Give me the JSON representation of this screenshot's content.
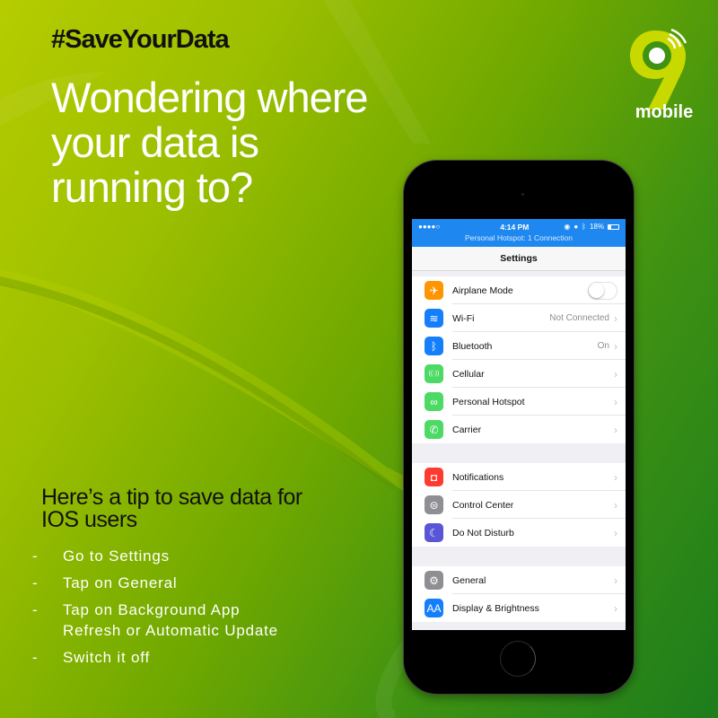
{
  "campaign": {
    "hashtag": "#SaveYourData",
    "headline": "Wondering where your data is running to?"
  },
  "brand": {
    "logo_icon": "9mobile-logo-icon",
    "name": "mobile",
    "colors": {
      "lime": "#b5cc00",
      "green": "#1d7d1c",
      "logo_lime": "#c8d900"
    }
  },
  "tip": {
    "title": "Here’s a tip to save data for IOS users",
    "bullet": "-",
    "steps": [
      "Go to Settings",
      "Tap on General",
      "Tap on Background App Refresh or Automatic Update",
      "Switch it off"
    ]
  },
  "phone": {
    "status_bar": {
      "signal": "●●●●○",
      "time": "4:14 PM",
      "icons": [
        "location-icon",
        "alarm-icon",
        "bluetooth-icon"
      ],
      "battery": "18%",
      "hotspot_banner": "Personal Hotspot: 1 Connection",
      "color": "#1e88f0"
    },
    "nav_title": "Settings",
    "groups": [
      [
        {
          "label": "Airplane Mode",
          "icon": "airplane-icon",
          "icon_color": "#ff9500",
          "toggle": false,
          "glyph": "✈"
        },
        {
          "label": "Wi-Fi",
          "icon": "wifi-icon",
          "icon_color": "#147efb",
          "value": "Not Connected",
          "glyph": "≋"
        },
        {
          "label": "Bluetooth",
          "icon": "bluetooth-icon",
          "icon_color": "#147efb",
          "value": "On",
          "glyph": "ᛒ"
        },
        {
          "label": "Cellular",
          "icon": "cellular-icon",
          "icon_color": "#4cd964",
          "value": "",
          "glyph": "((·))"
        },
        {
          "label": "Personal Hotspot",
          "icon": "hotspot-icon",
          "icon_color": "#4cd964",
          "value": "",
          "glyph": "∞"
        },
        {
          "label": "Carrier",
          "icon": "phone-icon",
          "icon_color": "#4cd964",
          "value": "",
          "glyph": "✆"
        }
      ],
      [
        {
          "label": "Notifications",
          "icon": "notifications-icon",
          "icon_color": "#ff3b30",
          "value": "",
          "glyph": "◘"
        },
        {
          "label": "Control Center",
          "icon": "control-center-icon",
          "icon_color": "#8e8e93",
          "value": "",
          "glyph": "⊜"
        },
        {
          "label": "Do Not Disturb",
          "icon": "moon-icon",
          "icon_color": "#5856d6",
          "value": "",
          "glyph": "☾"
        }
      ],
      [
        {
          "label": "General",
          "icon": "gear-icon",
          "icon_color": "#8e8e93",
          "value": "",
          "glyph": "⚙"
        },
        {
          "label": "Display & Brightness",
          "icon": "display-icon",
          "icon_color": "#147efb",
          "value": "",
          "glyph": "AA"
        }
      ]
    ],
    "chevron": "›"
  }
}
